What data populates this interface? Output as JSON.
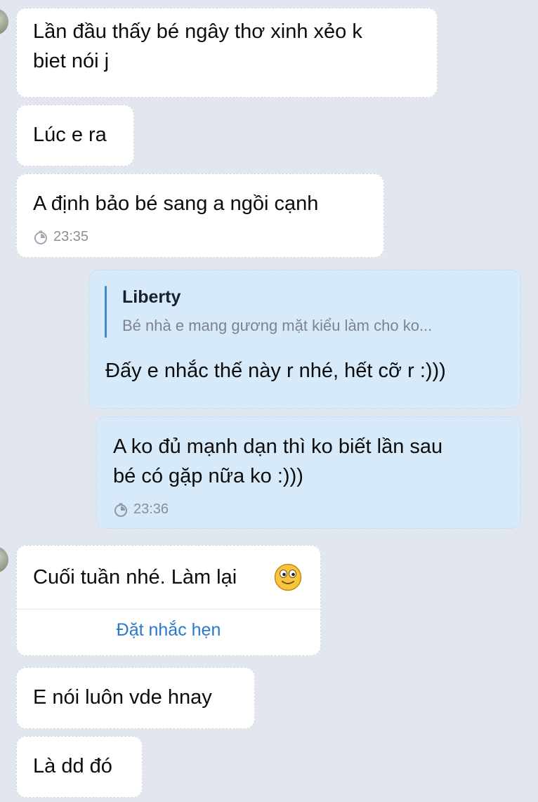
{
  "messages": [
    {
      "text_lines": [
        "Lần đầu thấy bé ngây thơ xinh xẻo k",
        "biet nói j"
      ]
    },
    {
      "text": "Lúc e ra"
    },
    {
      "text": "A định bảo bé sang a ngồi cạnh",
      "time": "23:35"
    },
    {
      "quote": {
        "name": "Liberty",
        "text": "Bé nhà e mang gương mặt kiểu làm cho ko..."
      },
      "text": "Đấy e nhắc thế này r nhé, hết cỡ r :)))"
    },
    {
      "text_lines": [
        "A ko đủ mạnh dạn thì ko biết lần sau",
        "bé có gặp nữa ko :)))"
      ],
      "time": "23:36"
    },
    {
      "text": "Cuối tuần nhé. Làm lại",
      "emoji": "smiley-emoji",
      "action": "Đặt nhắc hẹn"
    },
    {
      "text": "E nói luôn vde hnay"
    },
    {
      "text": "Là dd đó"
    }
  ],
  "colors": {
    "background": "#e2e6ee",
    "incoming_bubble": "#ffffff",
    "outgoing_bubble": "#d7eafa",
    "accent": "#2b78cf",
    "quote_bar": "#3f8ad6",
    "time": "#8b9098"
  }
}
